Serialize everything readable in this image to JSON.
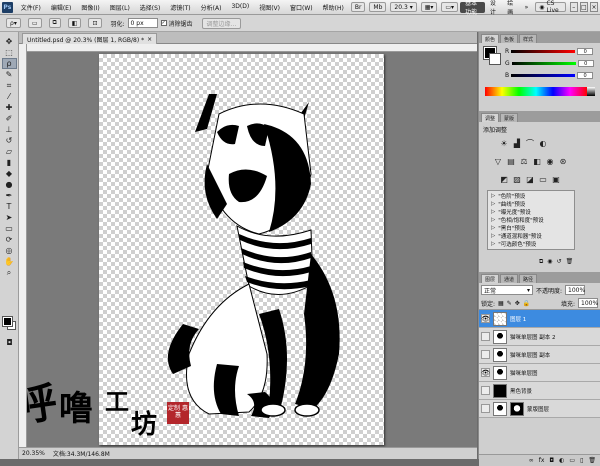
{
  "app": {
    "logo": "Ps",
    "zoom_select": "20.3",
    "menus": [
      "文件(F)",
      "编辑(E)",
      "图像(I)",
      "图层(L)",
      "选择(S)",
      "滤镜(T)",
      "分析(A)",
      "3D(D)",
      "视图(V)",
      "窗口(W)",
      "帮助(H)"
    ]
  },
  "workspace": {
    "buttons": [
      "基本功能",
      "设计",
      "绘画"
    ],
    "overflow": "»",
    "cslive": "CS Live"
  },
  "options": {
    "feather_label": "羽化:",
    "feather_value": "0 px",
    "antialias_label": "消除锯齿",
    "refine_edge": "调整边缘..."
  },
  "document": {
    "tab_title": "Untitled.psd @ 20.3% (图层 1, RGB/8) *",
    "close": "×"
  },
  "statusbar": {
    "zoom": "20.35%",
    "doc_size": "文档:34.3M/146.8M"
  },
  "color_panel": {
    "tabs": [
      "颜色",
      "色板",
      "样式"
    ],
    "channels": [
      {
        "label": "R",
        "value": "0"
      },
      {
        "label": "G",
        "value": "0"
      },
      {
        "label": "B",
        "value": "0"
      }
    ]
  },
  "adjustments": {
    "tabs": [
      "调整",
      "蒙版"
    ],
    "title": "添加调整",
    "presets": [
      "\"色阶\"预设",
      "\"曲线\"预设",
      "\"曝光度\"预设",
      "\"色相/饱和度\"预设",
      "\"黑白\"预设",
      "\"通道混和器\"预设",
      "\"可选颜色\"预设"
    ]
  },
  "layers_panel": {
    "tabs": [
      "图层",
      "通道",
      "路径"
    ],
    "blend_mode": "正常",
    "opacity_label": "不透明度:",
    "opacity": "100%",
    "lock_label": "锁定:",
    "fill_label": "填充:",
    "fill": "100%",
    "layers": [
      {
        "name": "图层 1",
        "selected": true,
        "visible": true
      },
      {
        "name": "猫咪单层图 副本 2",
        "selected": false,
        "visible": false
      },
      {
        "name": "猫咪单层图 副本",
        "selected": false,
        "visible": false
      },
      {
        "name": "猫咪单层图",
        "selected": false,
        "visible": true
      },
      {
        "name": "黑色背景",
        "selected": false,
        "visible": false
      },
      {
        "name": "蒙版图层",
        "selected": false,
        "visible": false
      }
    ]
  },
  "watermark": {
    "chars": [
      "呼",
      "噜",
      "工",
      "坊"
    ],
    "seal": "定制 惠蕙"
  }
}
